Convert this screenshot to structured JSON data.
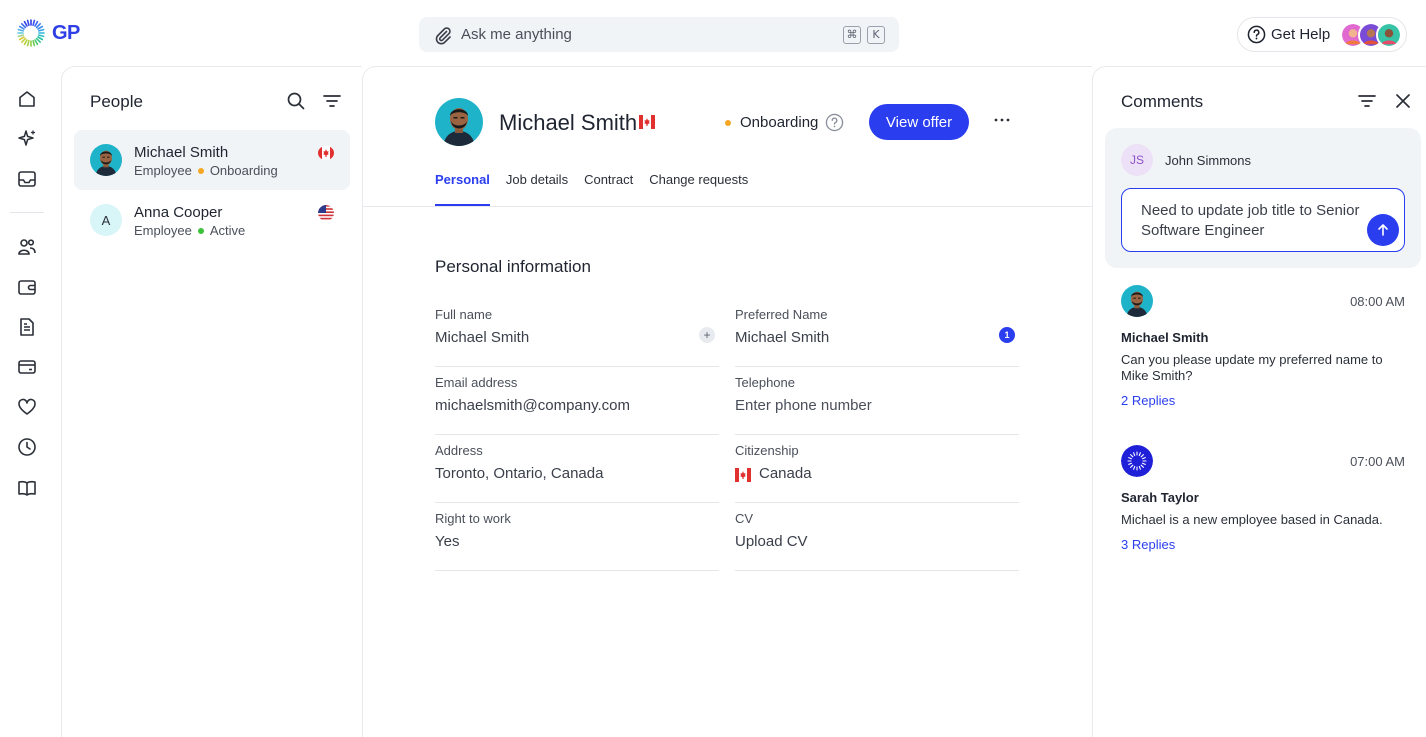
{
  "app": {
    "logo_text": "GP"
  },
  "search": {
    "placeholder": "Ask me anything",
    "shortcut_cmd": "⌘",
    "shortcut_key": "K"
  },
  "header": {
    "help_label": "Get Help"
  },
  "rail": {
    "items": [
      "home-icon",
      "sparkle-icon",
      "inbox-icon",
      "people-icon",
      "wallet-icon",
      "document-icon",
      "card-icon",
      "heart-icon",
      "clock-icon",
      "book-icon"
    ]
  },
  "people": {
    "title": "People",
    "items": [
      {
        "name": "Michael Smith",
        "role": "Employee",
        "status": "Onboarding",
        "status_color": "#f5a623",
        "flag": "canada-flag-icon"
      },
      {
        "name": "Anna Cooper",
        "initial": "A",
        "role": "Employee",
        "status": "Active",
        "status_color": "#3cc13b",
        "flag": "usa-flag-icon"
      }
    ]
  },
  "profile": {
    "name": "Michael Smith",
    "status": "Onboarding",
    "status_color": "#f5a623",
    "primary_button": "View offer",
    "tabs": [
      "Personal",
      "Job details",
      "Contract",
      "Change requests"
    ],
    "active_tab": "Personal"
  },
  "personal": {
    "title": "Personal information",
    "fields": [
      {
        "label": "Full name",
        "value": "Michael Smith"
      },
      {
        "label": "Preferred Name",
        "value": "Michael Smith",
        "badge": "1"
      },
      {
        "label": "Email address",
        "value": "michaelsmith@company.com"
      },
      {
        "label": "Telephone",
        "value": "Enter phone number"
      },
      {
        "label": "Address",
        "value": "Toronto, Ontario, Canada"
      },
      {
        "label": "Citizenship",
        "value": "Canada"
      },
      {
        "label": "Right to work",
        "value": "Yes"
      },
      {
        "label": "CV",
        "value": "Upload CV"
      }
    ]
  },
  "comments": {
    "title": "Comments",
    "composer": {
      "initials": "JS",
      "name": "John Simmons",
      "text": "Need to update job title to Senior Software Engineer"
    },
    "items": [
      {
        "author": "Michael Smith",
        "time": "08:00 AM",
        "text": "Can you please update my preferred name to Mike Smith?",
        "replies": "2 Replies"
      },
      {
        "author": "Sarah Taylor",
        "time": "07:00 AM",
        "text": "Michael is a new employee based in Canada.",
        "replies": "3 Replies"
      }
    ]
  },
  "colors": {
    "accent": "#2a3ef0",
    "panel_bg": "#f1f4f7"
  }
}
